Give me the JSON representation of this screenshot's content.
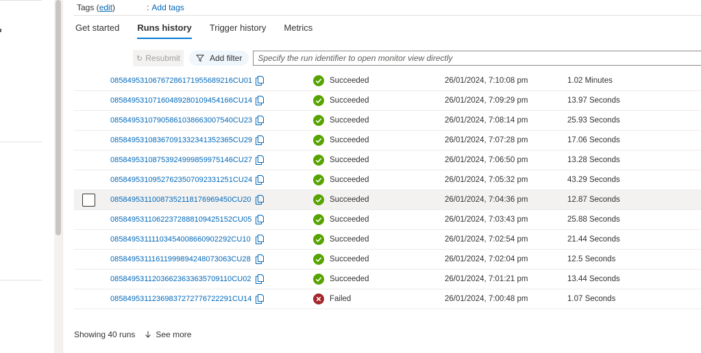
{
  "tags": {
    "label": "Tags (",
    "edit_link": "edit",
    "close_paren": ")",
    "colon": ":",
    "add_tags": "Add tags"
  },
  "tabs": [
    {
      "label": "Get started",
      "active": false
    },
    {
      "label": "Runs history",
      "active": true
    },
    {
      "label": "Trigger history",
      "active": false
    },
    {
      "label": "Metrics",
      "active": false
    }
  ],
  "toolbar": {
    "resubmit_label": "Resubmit",
    "add_filter_label": "Add filter",
    "search_placeholder": "Specify the run identifier to open monitor view directly"
  },
  "runs": [
    {
      "id": "08584953106767286171955689216CU01",
      "status": "Succeeded",
      "start": "26/01/2024, 7:10:08 pm",
      "duration": "1.02 Minutes"
    },
    {
      "id": "08584953107160489280109454166CU14",
      "status": "Succeeded",
      "start": "26/01/2024, 7:09:29 pm",
      "duration": "13.97 Seconds"
    },
    {
      "id": "08584953107905861038663007540CU23",
      "status": "Succeeded",
      "start": "26/01/2024, 7:08:14 pm",
      "duration": "25.93 Seconds"
    },
    {
      "id": "08584953108367091332341352365CU29",
      "status": "Succeeded",
      "start": "26/01/2024, 7:07:28 pm",
      "duration": "17.06 Seconds"
    },
    {
      "id": "08584953108753924999859975146CU27",
      "status": "Succeeded",
      "start": "26/01/2024, 7:06:50 pm",
      "duration": "13.28 Seconds"
    },
    {
      "id": "08584953109527623507092331251CU24",
      "status": "Succeeded",
      "start": "26/01/2024, 7:05:32 pm",
      "duration": "43.29 Seconds"
    },
    {
      "id": "08584953110087352118176969450CU20",
      "status": "Succeeded",
      "start": "26/01/2024, 7:04:36 pm",
      "duration": "12.87 Seconds"
    },
    {
      "id": "08584953110622372888109425152CU05",
      "status": "Succeeded",
      "start": "26/01/2024, 7:03:43 pm",
      "duration": "25.88 Seconds"
    },
    {
      "id": "08584953111103454008660902292CU10",
      "status": "Succeeded",
      "start": "26/01/2024, 7:02:54 pm",
      "duration": "21.44 Seconds"
    },
    {
      "id": "08584953111611999894248073063CU28",
      "status": "Succeeded",
      "start": "26/01/2024, 7:02:04 pm",
      "duration": "12.5 Seconds"
    },
    {
      "id": "08584953112036623633635709110CU02",
      "status": "Succeeded",
      "start": "26/01/2024, 7:01:21 pm",
      "duration": "13.44 Seconds"
    },
    {
      "id": "08584953112369837272776722291CU14",
      "status": "Failed",
      "start": "26/01/2024, 7:00:48 pm",
      "duration": "1.07 Seconds"
    }
  ],
  "hovered_row_index": 6,
  "footer": {
    "showing": "Showing 40 runs",
    "see_more": "See more"
  },
  "colors": {
    "link": "#0067b8",
    "success": "#57a300",
    "failed": "#a4262c",
    "accent": "#0078d4"
  },
  "icons": {
    "success": "checkmark-circle-icon",
    "failed": "error-circle-icon",
    "copy": "copy-icon",
    "filter": "filter-icon",
    "resubmit": "resubmit-icon",
    "see_more": "arrow-down-icon"
  }
}
